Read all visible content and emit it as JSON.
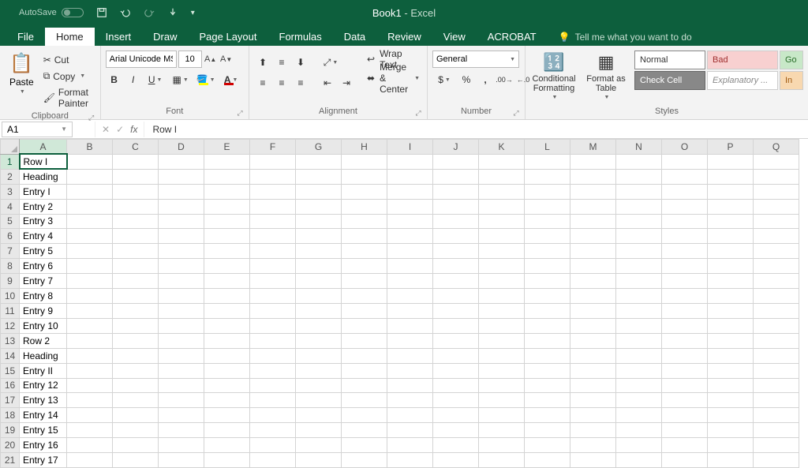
{
  "titlebar": {
    "autosave_label": "AutoSave",
    "autosave_off": "Off",
    "title_doc": "Book1",
    "title_app": " - Excel"
  },
  "tabs": {
    "file": "File",
    "home": "Home",
    "insert": "Insert",
    "draw": "Draw",
    "page_layout": "Page Layout",
    "formulas": "Formulas",
    "data": "Data",
    "review": "Review",
    "view": "View",
    "acrobat": "ACROBAT",
    "tell_me": "Tell me what you want to do"
  },
  "ribbon": {
    "clipboard": {
      "label": "Clipboard",
      "paste": "Paste",
      "cut": "Cut",
      "copy": "Copy",
      "format_painter": "Format Painter"
    },
    "font": {
      "label": "Font",
      "name": "Arial Unicode MS",
      "size": "10"
    },
    "alignment": {
      "label": "Alignment",
      "wrap": "Wrap Text",
      "merge": "Merge & Center"
    },
    "number": {
      "label": "Number",
      "format": "General"
    },
    "styles": {
      "label": "Styles",
      "conditional": "Conditional Formatting",
      "format_as": "Format as Table",
      "normal": "Normal",
      "bad": "Bad",
      "check": "Check Cell",
      "explanatory": "Explanatory ...",
      "go": "Go",
      "in": "In"
    }
  },
  "formula_bar": {
    "name_box": "A1",
    "formula": "Row I"
  },
  "grid": {
    "columns": [
      "A",
      "B",
      "C",
      "D",
      "E",
      "F",
      "G",
      "H",
      "I",
      "J",
      "K",
      "L",
      "M",
      "N",
      "O",
      "P",
      "Q"
    ],
    "active_col": "A",
    "active_row": 1,
    "rows": [
      {
        "n": 1,
        "a": "Row I"
      },
      {
        "n": 2,
        "a": "Heading"
      },
      {
        "n": 3,
        "a": "Entry I"
      },
      {
        "n": 4,
        "a": "Entry 2"
      },
      {
        "n": 5,
        "a": "Entry 3"
      },
      {
        "n": 6,
        "a": "Entry 4"
      },
      {
        "n": 7,
        "a": "Entry 5"
      },
      {
        "n": 8,
        "a": "Entry 6"
      },
      {
        "n": 9,
        "a": "Entry 7"
      },
      {
        "n": 10,
        "a": "Entry 8"
      },
      {
        "n": 11,
        "a": "Entry 9"
      },
      {
        "n": 12,
        "a": "Entry 10"
      },
      {
        "n": 13,
        "a": "Row 2"
      },
      {
        "n": 14,
        "a": "Heading"
      },
      {
        "n": 15,
        "a": "Entry II"
      },
      {
        "n": 16,
        "a": "Entry 12"
      },
      {
        "n": 17,
        "a": "Entry 13"
      },
      {
        "n": 18,
        "a": "Entry 14"
      },
      {
        "n": 19,
        "a": "Entry 15"
      },
      {
        "n": 20,
        "a": "Entry 16"
      },
      {
        "n": 21,
        "a": "Entry 17"
      }
    ]
  }
}
